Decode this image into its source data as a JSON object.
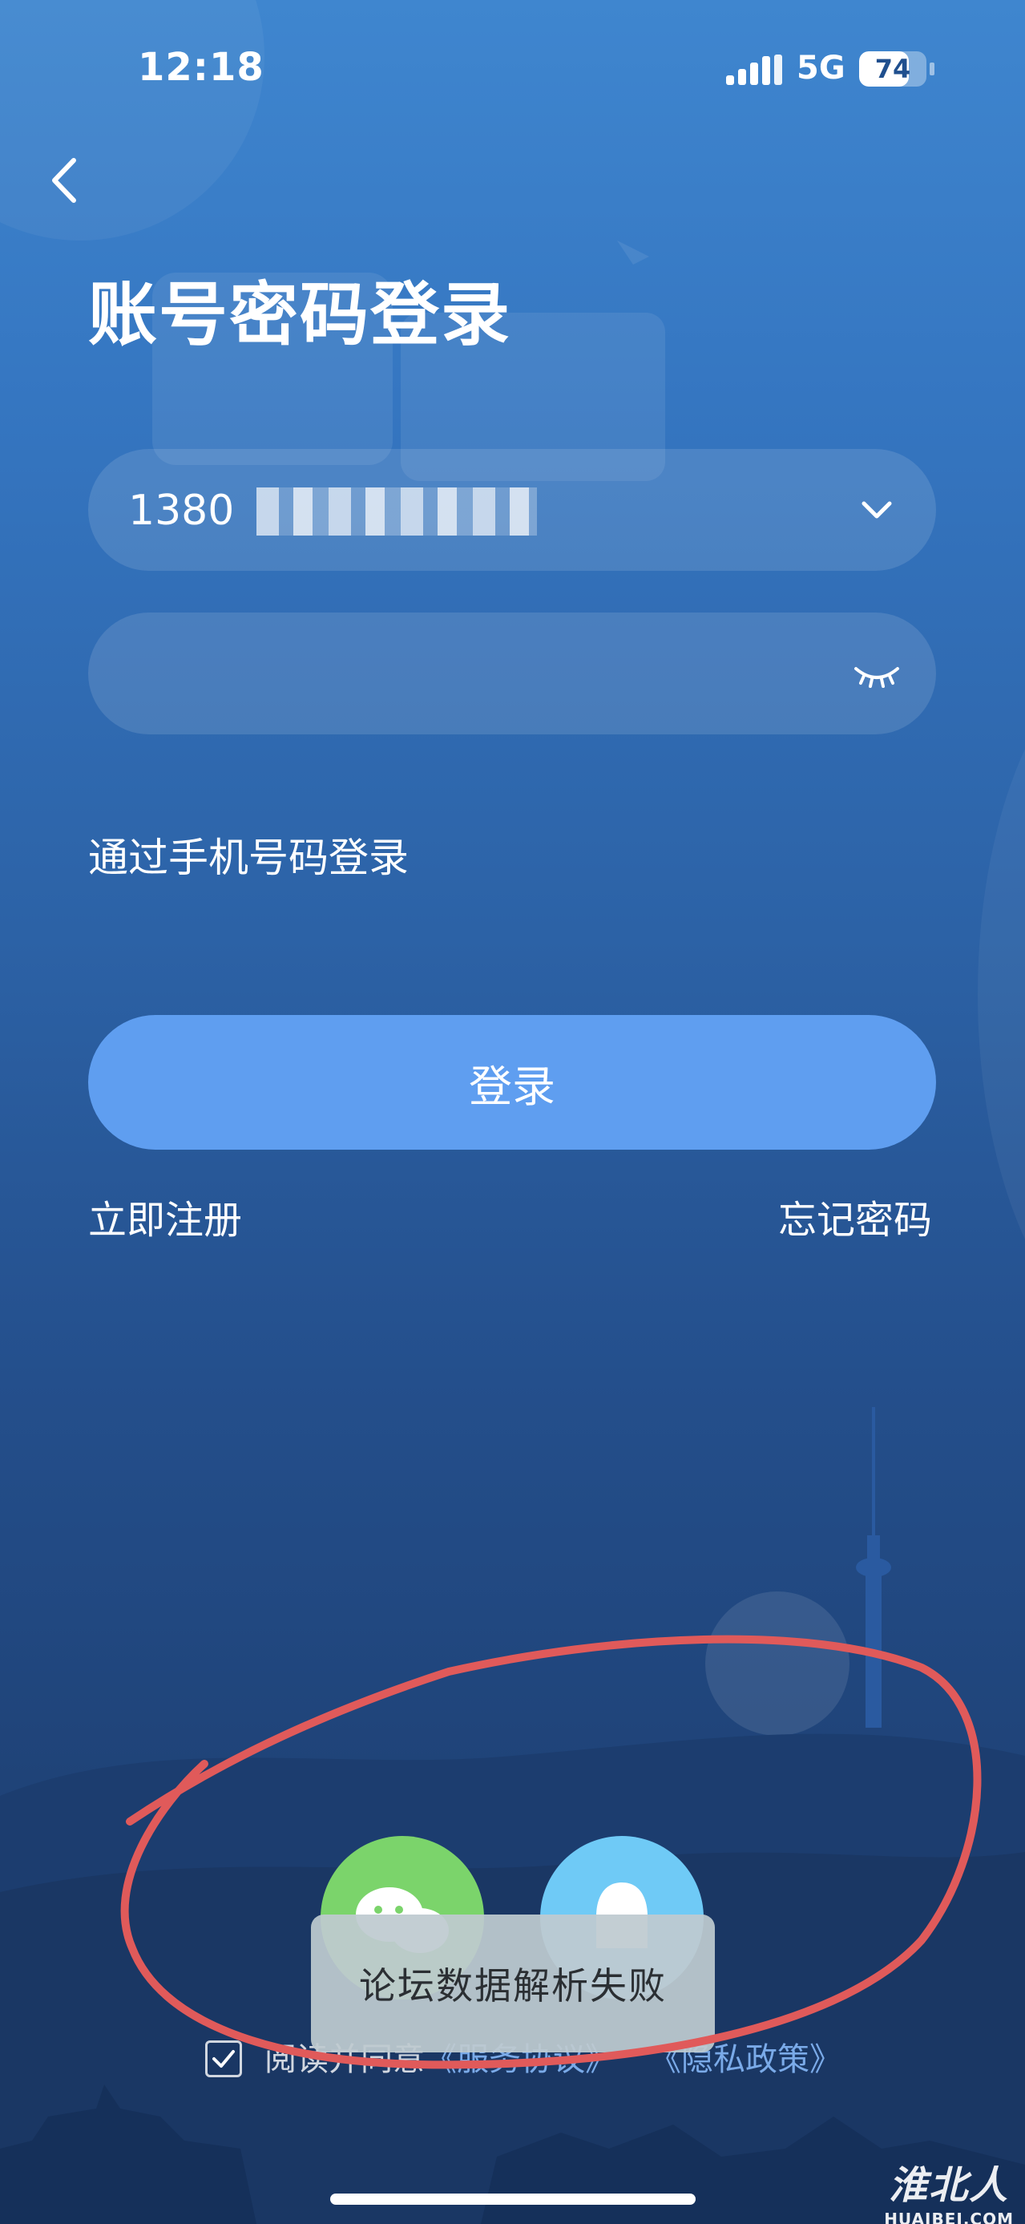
{
  "status_bar": {
    "time": "12:18",
    "network": "5G",
    "battery": "74",
    "battery_level_percent": 74
  },
  "header": {
    "title": "账号密码登录"
  },
  "account_field": {
    "value": "1380",
    "placeholder": ""
  },
  "password_field": {
    "value": "",
    "placeholder": ""
  },
  "links": {
    "phone_login": "通过手机号码登录",
    "register": "立即注册",
    "forgot_password": "忘记密码"
  },
  "login_button": {
    "label": "登录"
  },
  "agreement": {
    "prefix": "阅读并同意",
    "terms": "《服务协议》",
    "privacy": "《隐私政策》"
  },
  "toast": {
    "message": "论坛数据解析失败"
  },
  "watermark": {
    "main": "淮北人",
    "sub": "HUAIBEI.COM"
  },
  "colors": {
    "login_button": "#5f9ef0",
    "wechat": "#7bd46b",
    "qq": "#6fcaf6",
    "annotation": "#e05a5a"
  },
  "icons": {
    "back": "chevron-left",
    "dropdown": "chevron-down",
    "password_toggle": "eye-closed",
    "wechat": "wechat-logo",
    "qq": "qq-logo"
  }
}
